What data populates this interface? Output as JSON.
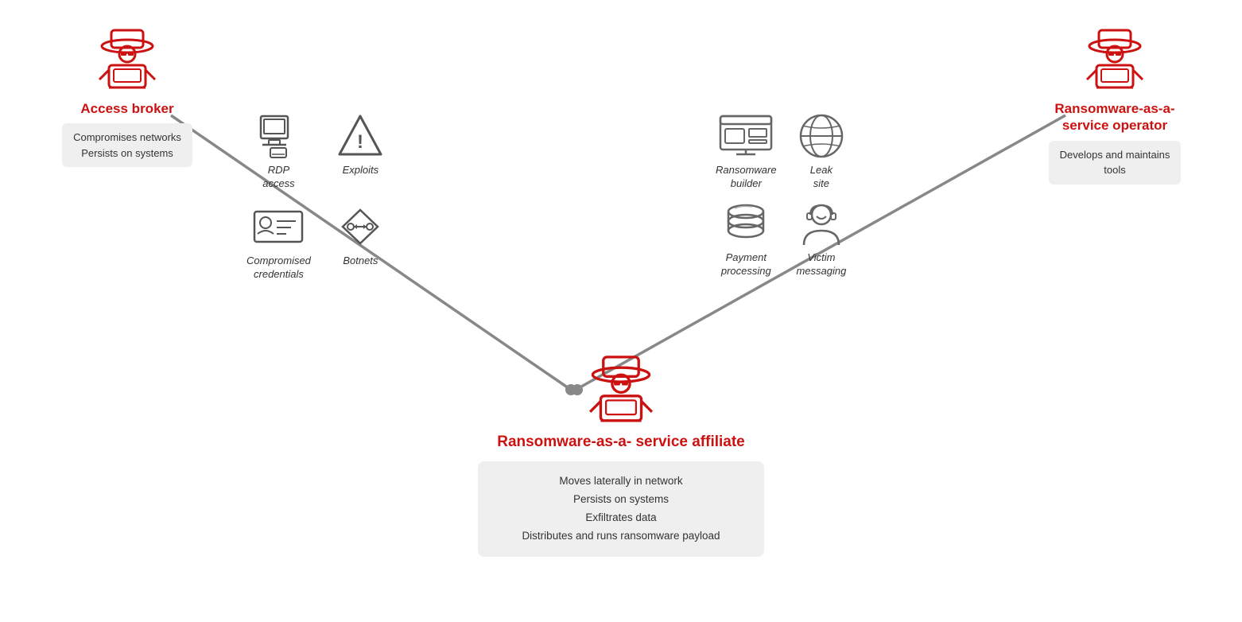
{
  "actors": {
    "access_broker": {
      "label": "Access\nbroker",
      "desc": "Compromises networks\nPersists on systems"
    },
    "raas_operator": {
      "label": "Ransomware-as-a-\nservice operator",
      "desc": "Develops and maintains\ntools"
    },
    "raas_affiliate": {
      "label": "Ransomware-as-a-\nservice affiliate",
      "desc": "Moves laterally in network\nPersists on systems\nExfiltrates data\nDistributes and runs ransomware payload"
    }
  },
  "access_tools": [
    {
      "label": "RDP\naccess",
      "icon": "rdp"
    },
    {
      "label": "Exploits",
      "icon": "exploits"
    },
    {
      "label": "Compromised\ncredentials",
      "icon": "credentials"
    },
    {
      "label": "Botnets",
      "icon": "botnets"
    }
  ],
  "operator_tools": [
    {
      "label": "Ransomware\nbuilder",
      "icon": "ransomware"
    },
    {
      "label": "Leak\nsite",
      "icon": "leak"
    },
    {
      "label": "Payment\nprocessing",
      "icon": "payment"
    },
    {
      "label": "Victim\nmessaging",
      "icon": "messaging"
    }
  ]
}
